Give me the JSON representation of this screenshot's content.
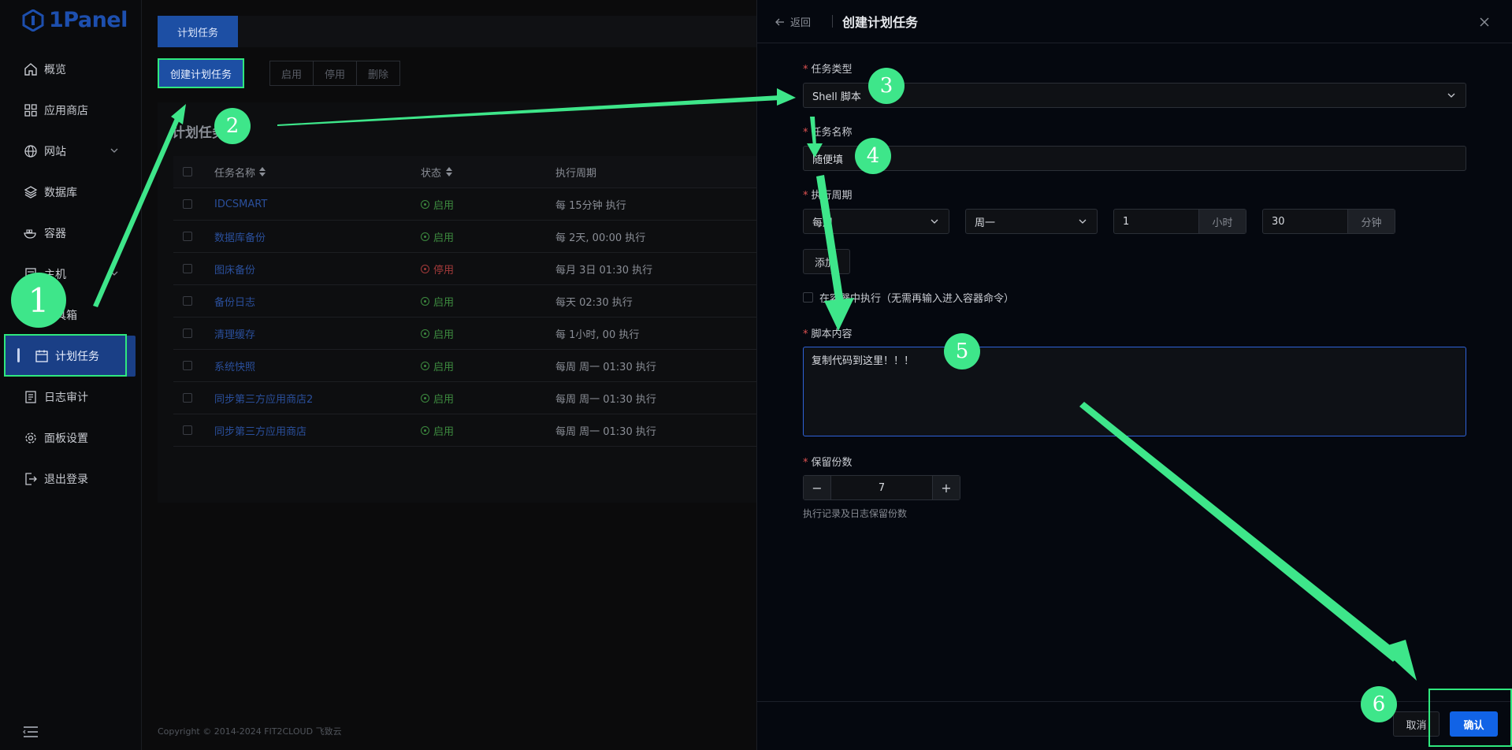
{
  "app": {
    "logo_text": "1Panel"
  },
  "sidebar": {
    "items": [
      {
        "label": "概览",
        "icon": "home-icon"
      },
      {
        "label": "应用商店",
        "icon": "apps-icon"
      },
      {
        "label": "网站",
        "icon": "globe-icon",
        "expandable": true
      },
      {
        "label": "数据库",
        "icon": "database-icon"
      },
      {
        "label": "容器",
        "icon": "docker-icon"
      },
      {
        "label": "主机",
        "icon": "host-icon",
        "expandable": true
      },
      {
        "label": "工具箱",
        "icon": "toolbox-icon"
      },
      {
        "label": "计划任务",
        "icon": "calendar-icon",
        "active": true
      },
      {
        "label": "日志审计",
        "icon": "log-icon"
      },
      {
        "label": "面板设置",
        "icon": "gear-icon"
      },
      {
        "label": "退出登录",
        "icon": "logout-icon"
      }
    ]
  },
  "main": {
    "tab": "计划任务",
    "toolbar": {
      "create": "创建计划任务",
      "enable": "启用",
      "disable": "停用",
      "delete": "删除"
    },
    "panel_title": "计划任务",
    "table": {
      "headers": {
        "name": "任务名称",
        "status": "状态",
        "cycle": "执行周期"
      },
      "rows": [
        {
          "name": "IDCSMART",
          "status": "启用",
          "enabled": true,
          "cycle": "每 15分钟 执行"
        },
        {
          "name": "数据库备份",
          "status": "启用",
          "enabled": true,
          "cycle": "每 2天, 00:00 执行"
        },
        {
          "name": "图床备份",
          "status": "停用",
          "enabled": false,
          "cycle": "每月 3日 01:30 执行"
        },
        {
          "name": "备份日志",
          "status": "启用",
          "enabled": true,
          "cycle": "每天 02:30 执行"
        },
        {
          "name": "清理缓存",
          "status": "启用",
          "enabled": true,
          "cycle": "每 1小时, 00 执行"
        },
        {
          "name": "系统快照",
          "status": "启用",
          "enabled": true,
          "cycle": "每周 周一 01:30 执行"
        },
        {
          "name": "同步第三方应用商店2",
          "status": "启用",
          "enabled": true,
          "cycle": "每周 周一 01:30 执行"
        },
        {
          "name": "同步第三方应用商店",
          "status": "启用",
          "enabled": true,
          "cycle": "每周 周一 01:30 执行"
        }
      ]
    },
    "footer": "Copyright © 2014-2024 FIT2CLOUD 飞致云"
  },
  "drawer": {
    "back": "返回",
    "title": "创建计划任务",
    "task_type": {
      "label": "任务类型",
      "value": "Shell 脚本"
    },
    "task_name": {
      "label": "任务名称",
      "value": "随便填"
    },
    "cycle": {
      "label": "执行周期",
      "period": "每周",
      "weekday": "周一",
      "hour": "1",
      "hour_unit": "小时",
      "minute": "30",
      "minute_unit": "分钟",
      "add_button": "添加"
    },
    "container_checkbox": "在容器中执行（无需再输入进入容器命令）",
    "script": {
      "label": "脚本内容",
      "value": "复制代码到这里！！！"
    },
    "retain": {
      "label": "保留份数",
      "value": "7",
      "minus": "−",
      "plus": "+",
      "hint": "执行记录及日志保留份数"
    },
    "cancel": "取消",
    "confirm": "确认"
  },
  "annotations": {
    "badges": [
      "1",
      "2",
      "3",
      "4",
      "5",
      "6"
    ],
    "color": "#3ee68a"
  }
}
